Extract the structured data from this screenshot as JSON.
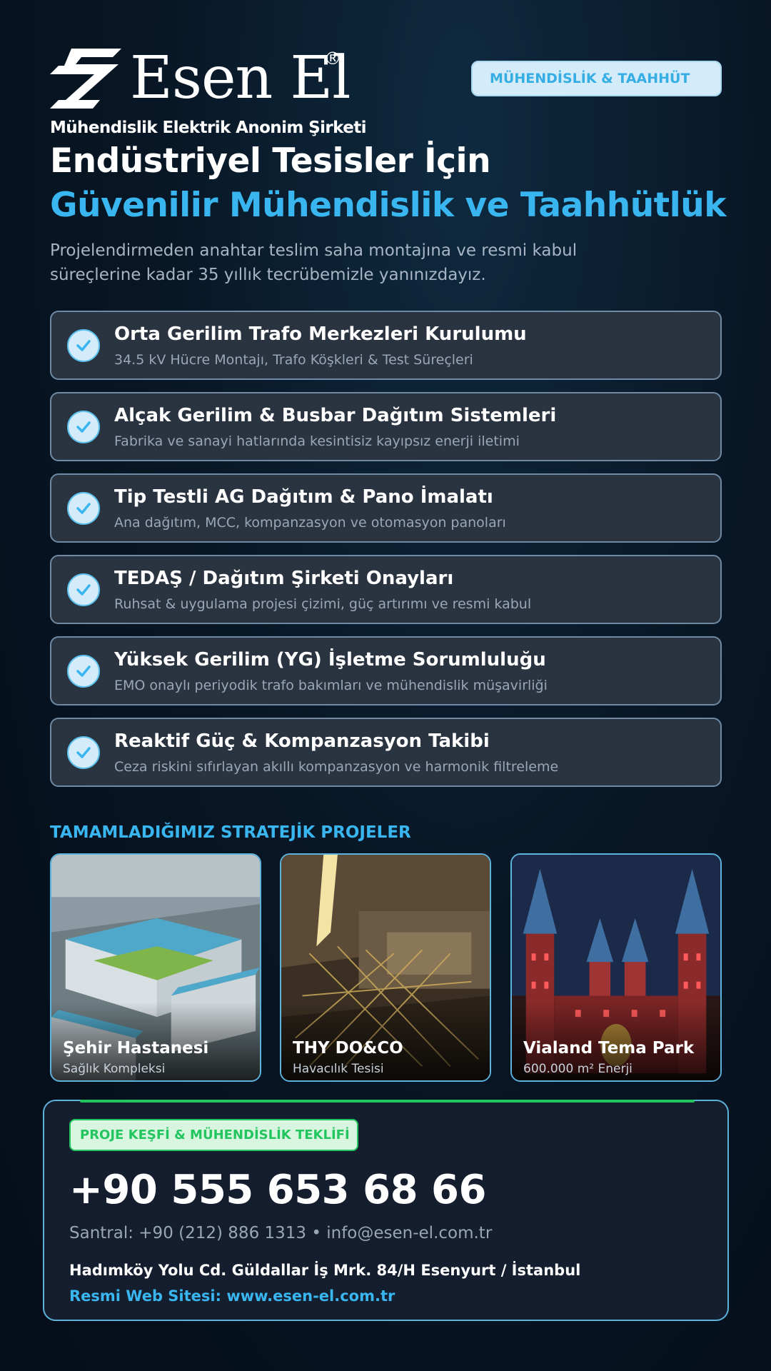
{
  "brand": {
    "name": "Esen El",
    "registered": "®",
    "tagline": "Mühendislik Elektrik Anonim Şirketi",
    "badge": "MÜHENDİSLİK & TAAHHÜT"
  },
  "hero": {
    "title_line1": "Endüstriyel Tesisler İçin",
    "title_line2": "Güvenilir Mühendislik ve Taahhütlük",
    "intro": "Projelendirmeden anahtar teslim saha montajına ve resmi kabul süreçlerine kadar 35 yıllık tecrübemizle yanınızdayız."
  },
  "services": [
    {
      "title": "Orta Gerilim Trafo Merkezleri Kurulumu",
      "subtitle": "34.5 kV Hücre Montajı, Trafo Köşkleri & Test Süreçleri",
      "icon": "check-icon"
    },
    {
      "title": "Alçak Gerilim & Busbar Dağıtım Sistemleri",
      "subtitle": "Fabrika ve sanayi hatlarında kesintisiz kayıpsız enerji iletimi",
      "icon": "check-icon"
    },
    {
      "title": "Tip Testli AG Dağıtım & Pano İmalatı",
      "subtitle": "Ana dağıtım, MCC, kompanzasyon ve otomasyon panoları",
      "icon": "check-icon"
    },
    {
      "title": "TEDAŞ / Dağıtım Şirketi Onayları",
      "subtitle": "Ruhsat & uygulama projesi çizimi, güç artırımı ve resmi kabul",
      "icon": "check-icon"
    },
    {
      "title": "Yüksek Gerilim (YG) İşletme Sorumluluğu",
      "subtitle": "EMO onaylı periyodik trafo bakımları ve mühendislik müşavirliği",
      "icon": "check-icon"
    },
    {
      "title": "Reaktif Güç & Kompanzasyon Takibi",
      "subtitle": "Ceza riskini sıfırlayan akıllı kompanzasyon ve harmonik filtreleme",
      "icon": "check-icon"
    }
  ],
  "projects": {
    "heading": "TAMAMLADIĞIMIZ STRATEJİK PROJELER",
    "items": [
      {
        "name": "Şehir Hastanesi",
        "subtitle": "Sağlık Kompleksi"
      },
      {
        "name": "THY DO&CO",
        "subtitle": "Havacılık Tesisi"
      },
      {
        "name": "Vialand Tema Park",
        "subtitle": "600.000 m² Enerji"
      }
    ]
  },
  "contact": {
    "badge": "PROJE KEŞFİ & MÜHENDİSLİK TEKLİFİ",
    "phone": "+90 555 653 68 66",
    "meta": "Santral: +90 (212) 886 1313  •  info@esen-el.com.tr",
    "address": "Hadımköy Yolu Cd. Güldallar İş Mrk. 84/H Esenyurt / İstanbul",
    "website": "Resmi Web Sitesi: www.esen-el.com.tr"
  },
  "colors": {
    "accent": "#39b5ef",
    "success": "#22c55e",
    "card_bg": "#2a3340",
    "page_bg": "#081726"
  }
}
